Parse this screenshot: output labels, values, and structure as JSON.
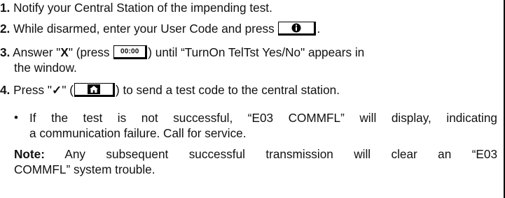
{
  "steps": [
    {
      "number": "1.",
      "text": "Notify your Central Station of the impending test."
    },
    {
      "number": "2.",
      "text_before": "While disarmed, enter your User Code and press",
      "text_after": ".",
      "key_icon": "info-icon"
    },
    {
      "number": "3.",
      "text_before": "Answer \"",
      "answer": "X",
      "text_middle": "\" (press",
      "key_label": "00:00",
      "text_after_line1": ") until “TurnOn TelTst Yes/No\" appears in",
      "text_line2": "the window."
    },
    {
      "number": "4.",
      "text_before": "Press \"",
      "check": "✓",
      "text_middle": "\" (",
      "key_icon": "home-icon",
      "text_after": ") to send a test code to the central station."
    }
  ],
  "bullet": {
    "symbol": "•",
    "line1": "If the test is not successful, “E03 COMMFL” will display, indicating",
    "line2": "a communication failure.  Call for service."
  },
  "note": {
    "label": "Note:",
    "line1": "Any subsequent successful transmission will clear an “E03",
    "line2": "COMMFL” system trouble."
  }
}
